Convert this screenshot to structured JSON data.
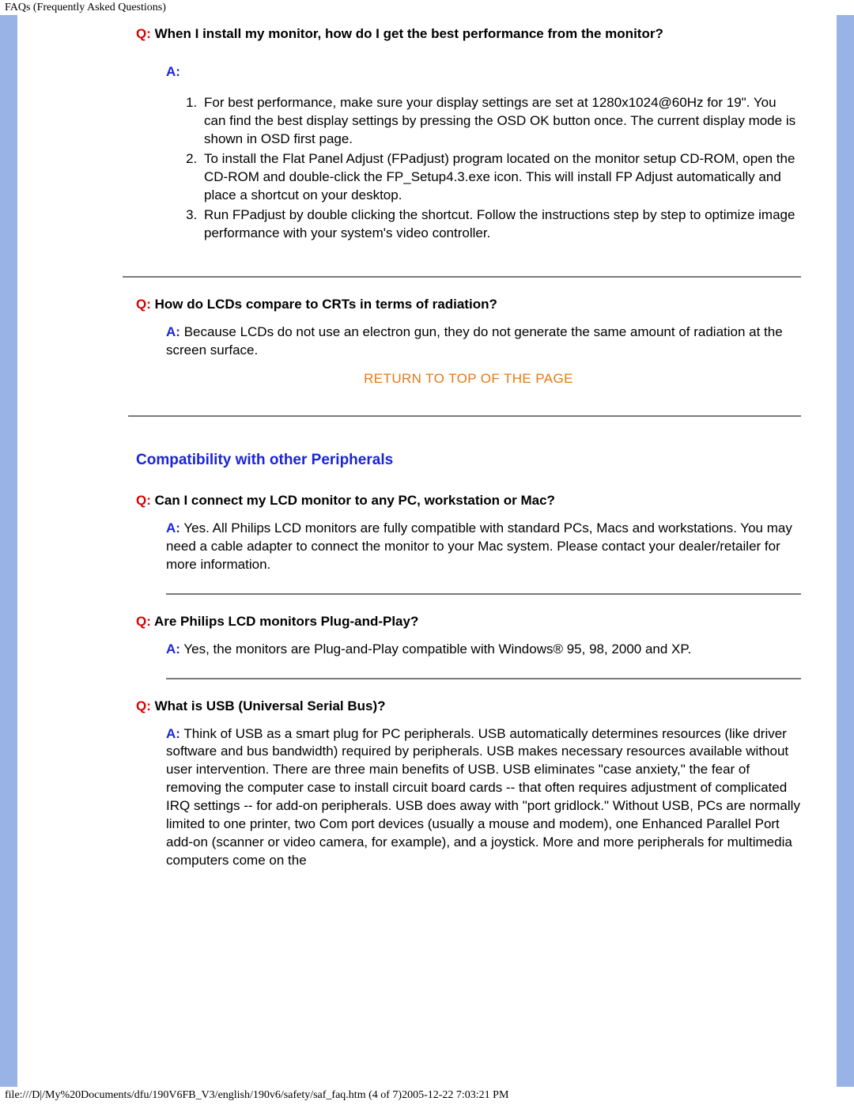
{
  "header": {
    "title": "FAQs (Frequently Asked Questions)"
  },
  "footer": {
    "text": "file:///D|/My%20Documents/dfu/190V6FB_V3/english/190v6/safety/saf_faq.htm (4 of 7)2005-12-22 7:03:21 PM"
  },
  "labels": {
    "q": "Q:",
    "a": "A:"
  },
  "return_link": "RETURN TO TOP OF THE PAGE",
  "faq1": {
    "q": "When I install my monitor, how do I get the best performance from the monitor?",
    "list": [
      "For best performance, make sure your display settings are set at 1280x1024@60Hz for 19\". You can find the best display settings by pressing the OSD OK button once. The current display mode is shown in OSD first page.",
      "To install the Flat Panel Adjust (FPadjust) program located on the monitor setup CD-ROM, open the CD-ROM and double-click the FP_Setup4.3.exe icon. This will install FP Adjust automatically and place a shortcut on your desktop.",
      "Run FPadjust by double clicking the shortcut. Follow the instructions step by step to optimize image performance with your system's video controller."
    ]
  },
  "faq2": {
    "q": "How do LCDs compare to CRTs in terms of radiation?",
    "a": "Because LCDs do not use an electron gun, they do not generate the same amount of radiation at the screen surface."
  },
  "section2": {
    "title": "Compatibility with other Peripherals"
  },
  "faq3": {
    "q": "Can I connect my LCD monitor to any PC, workstation or Mac?",
    "a": "Yes. All Philips LCD monitors are fully compatible with standard PCs, Macs and workstations. You may need a cable adapter to connect the monitor to your Mac system. Please contact your dealer/retailer for more information."
  },
  "faq4": {
    "q": "Are Philips LCD monitors Plug-and-Play?",
    "a": "Yes, the monitors are Plug-and-Play compatible with Windows® 95, 98, 2000 and XP."
  },
  "faq5": {
    "q": "What is USB (Universal Serial Bus)?",
    "a": "Think of USB as a smart plug for PC peripherals. USB automatically determines resources (like driver software and bus bandwidth) required by peripherals. USB makes necessary resources available without user intervention. There are three main benefits of USB. USB eliminates \"case anxiety,\" the fear of removing the computer case to install circuit board cards -- that often requires adjustment of complicated IRQ settings -- for add-on peripherals. USB does away with \"port gridlock.\" Without USB, PCs are normally limited to one printer, two Com port devices (usually a mouse and modem), one Enhanced Parallel Port add-on (scanner or video camera, for example), and a joystick. More and more peripherals for multimedia computers come on the"
  }
}
